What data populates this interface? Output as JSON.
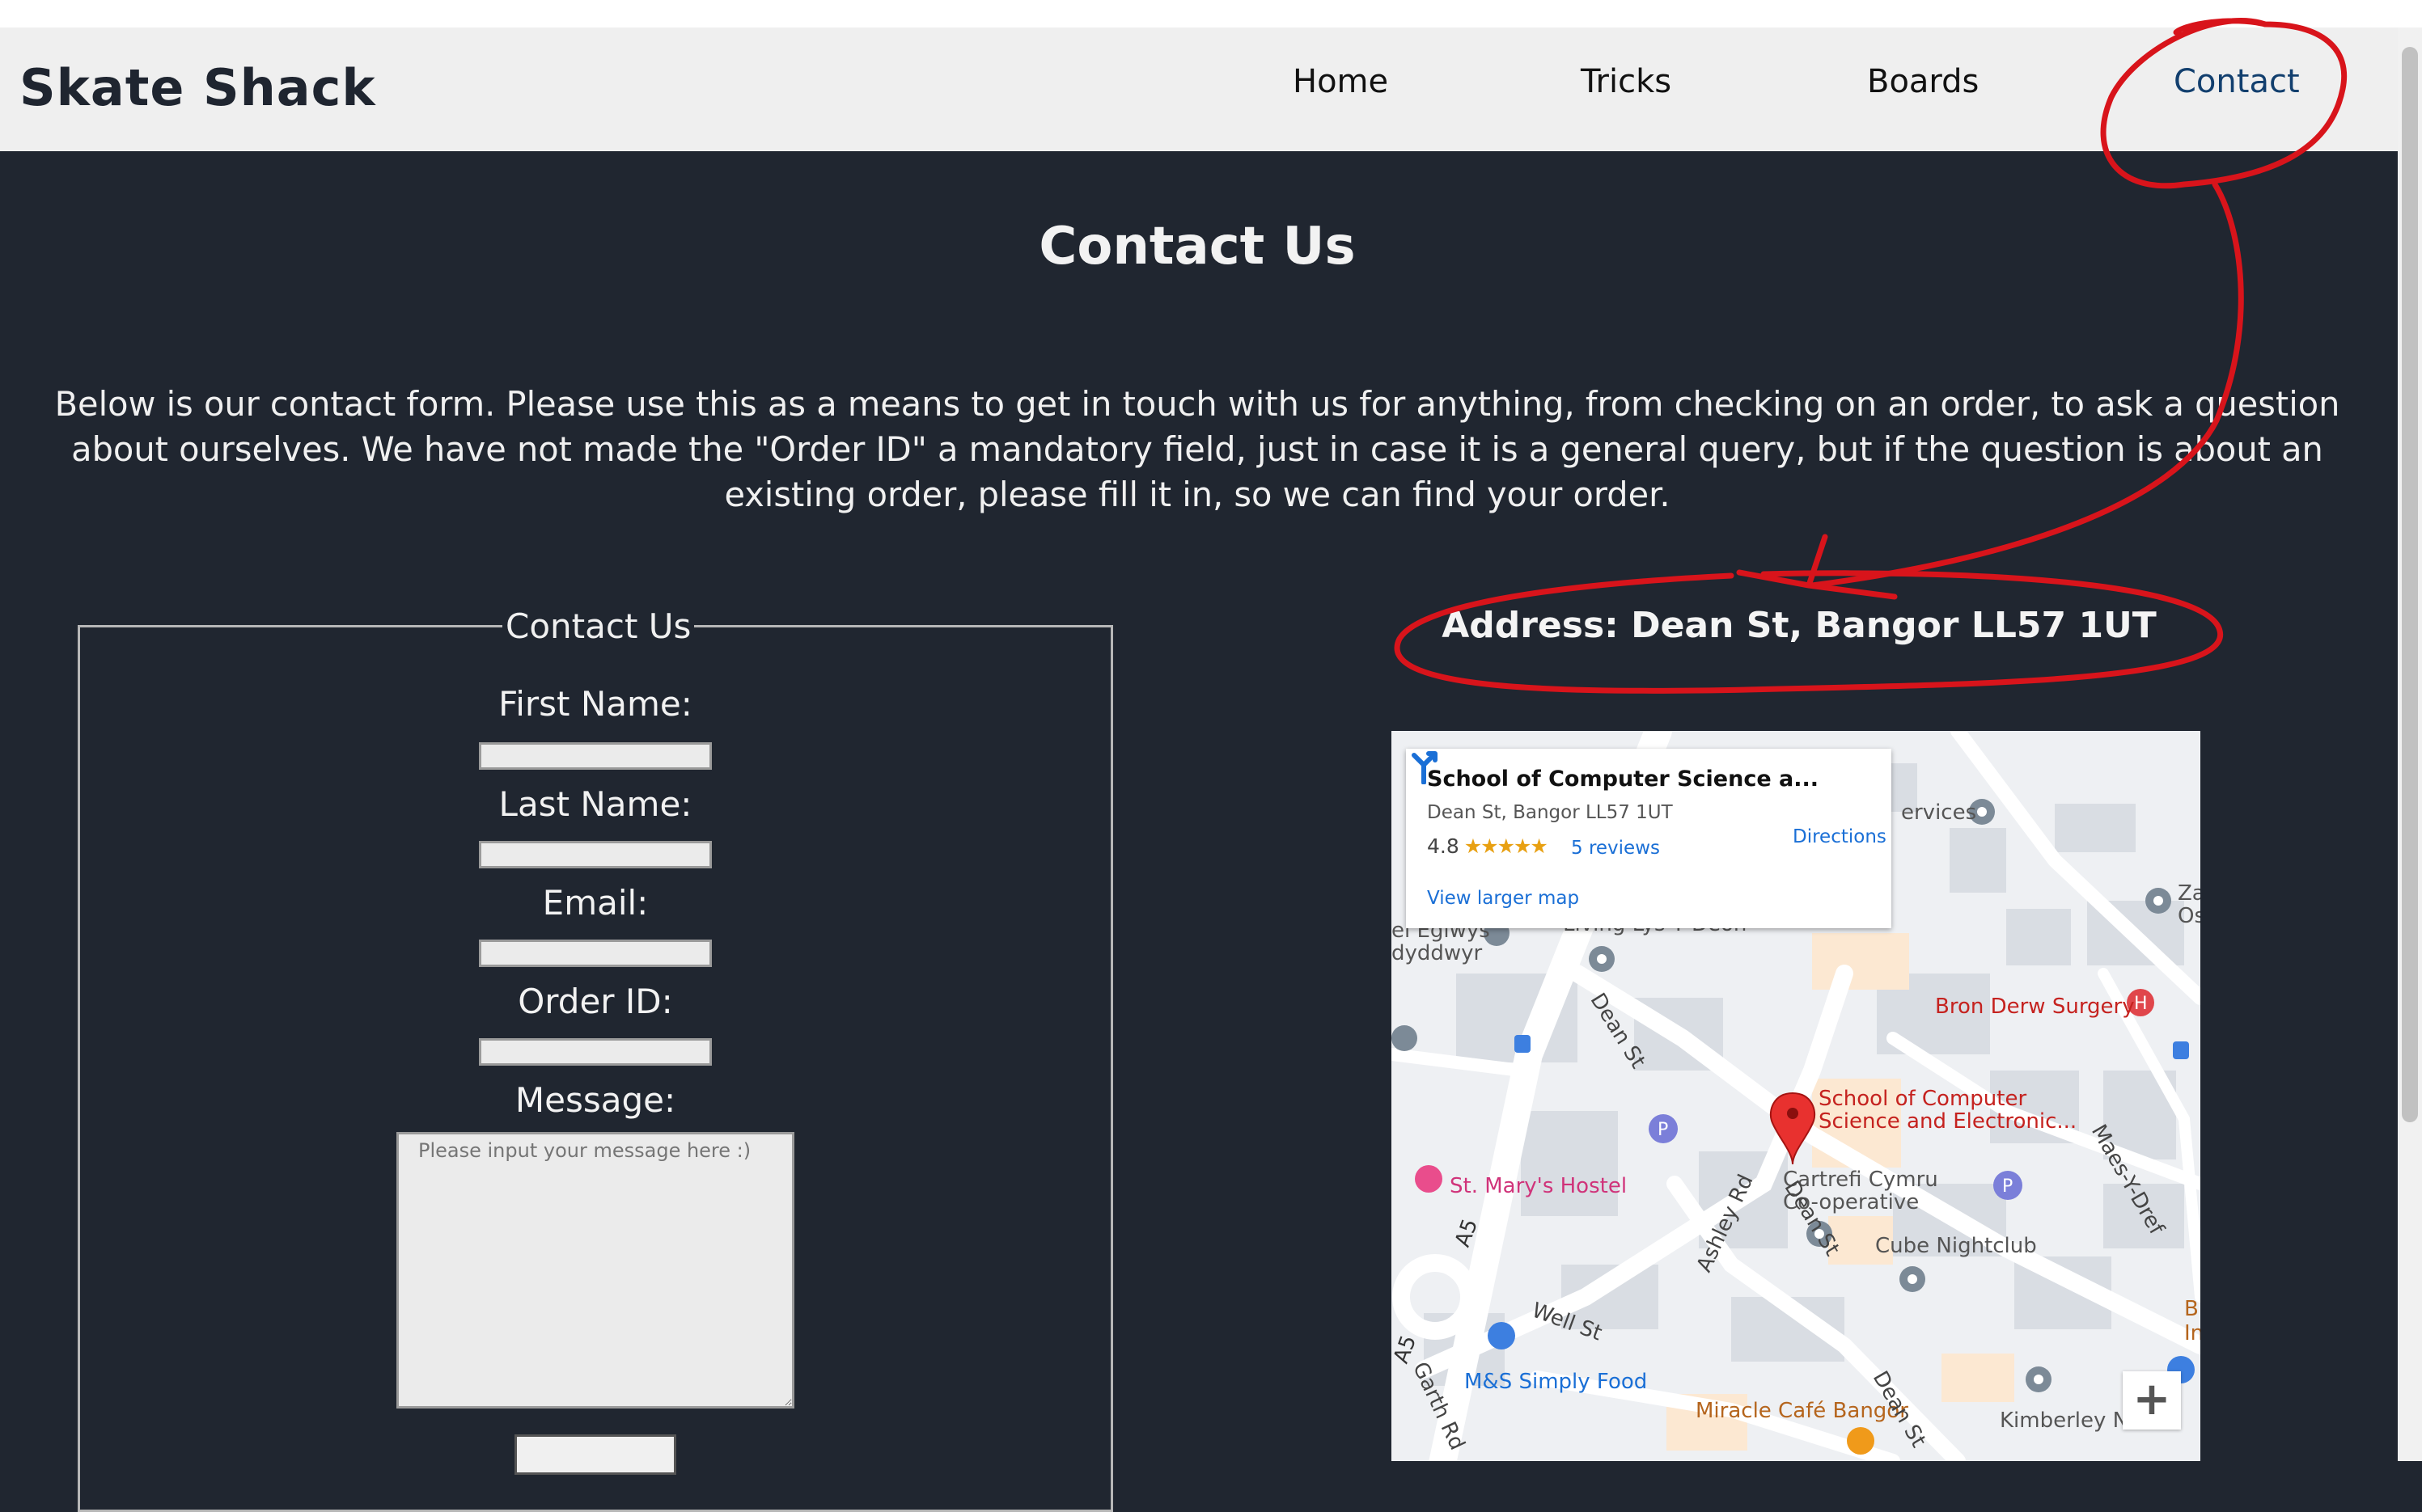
{
  "brand": "Skate Shack",
  "nav": {
    "home": "Home",
    "tricks": "Tricks",
    "boards": "Boards",
    "contact": "Contact"
  },
  "page": {
    "title": "Contact Us",
    "intro": "Below is our contact form. Please use this as a means to get in touch with us for anything, from checking on an order, to ask a question about ourselves. We have not made the \"Order ID\" a mandatory field, just in case it is a general query, but if the question is about an existing order, please fill it in, so we can find your order."
  },
  "form": {
    "legend": "Contact Us",
    "first_name_label": "First Name:",
    "last_name_label": "Last Name:",
    "email_label": "Email:",
    "order_id_label": "Order ID:",
    "message_label": "Message:",
    "message_placeholder": "Please input your message here :)"
  },
  "address": "Address: Dean St, Bangor LL57 1UT",
  "map": {
    "card": {
      "title": "School of Computer Science a...",
      "address": "Dean St, Bangor LL57 1UT",
      "rating": "4.8",
      "stars": "★★★★★",
      "reviews": "5 reviews",
      "larger_map": "View larger map",
      "directions": "Directions"
    },
    "places": {
      "services": "ervices",
      "za": "Za",
      "os": "Os",
      "eglwys": "el Eglwys",
      "dyddwyr": "dyddwyr",
      "living": "Living Lys Y Deon",
      "bron_derw": "Bron Derw Surgery",
      "dean_st": "Dean St",
      "school_line1": "School of Computer",
      "school_line2": "Science and Electronic...",
      "st_marys": "St. Mary's Hostel",
      "cartrefi_line1": "Cartrefi Cymru",
      "cartrefi_line2": "Co-operative",
      "maes": "Maes-Y-Dref",
      "cube": "Cube Nightclub",
      "a5": "A5",
      "ashley": "Ashley Rd",
      "well": "Well St",
      "ms": "M&S Simply Food",
      "garth": "Garth Rd",
      "miracle": "Miracle Café Bangor",
      "kimberley": "Kimberley N",
      "b_in": "B In"
    },
    "zoom_in": "+"
  },
  "colors": {
    "background": "#202630",
    "navbar": "#efefef",
    "nav_active": "#123f6e",
    "annotation": "#d8141b",
    "map_red_label": "#c5221f",
    "map_orange_label": "#b5651d",
    "map_link": "#1a6fd6"
  }
}
